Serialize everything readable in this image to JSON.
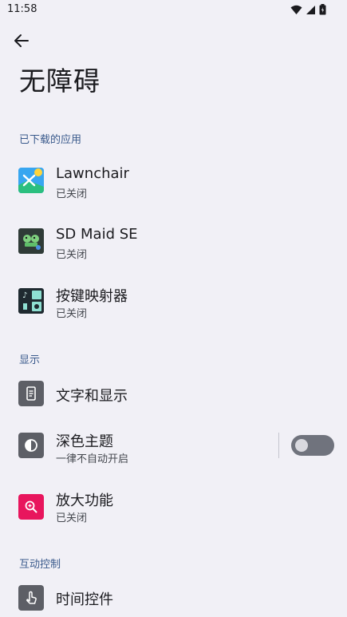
{
  "status": {
    "time": "11:58"
  },
  "header": {
    "title": "无障碍"
  },
  "sections": {
    "downloaded": "已下载的应用",
    "display": "显示",
    "interaction": "互动控制"
  },
  "apps": [
    {
      "label": "Lawnchair",
      "sub": "已关闭"
    },
    {
      "label": "SD Maid SE",
      "sub": "已关闭"
    },
    {
      "label": "按键映射器",
      "sub": "已关闭"
    }
  ],
  "display": {
    "text_display": "文字和显示",
    "dark_theme": {
      "label": "深色主题",
      "sub": "一律不自动开启",
      "enabled": false
    },
    "magnification": {
      "label": "放大功能",
      "sub": "已关闭"
    }
  },
  "interaction": {
    "timing": "时间控件"
  },
  "colors": {
    "accent_section": "#3a5a8c",
    "background": "#f1f0f6",
    "magnify_icon": "#e8155d"
  }
}
